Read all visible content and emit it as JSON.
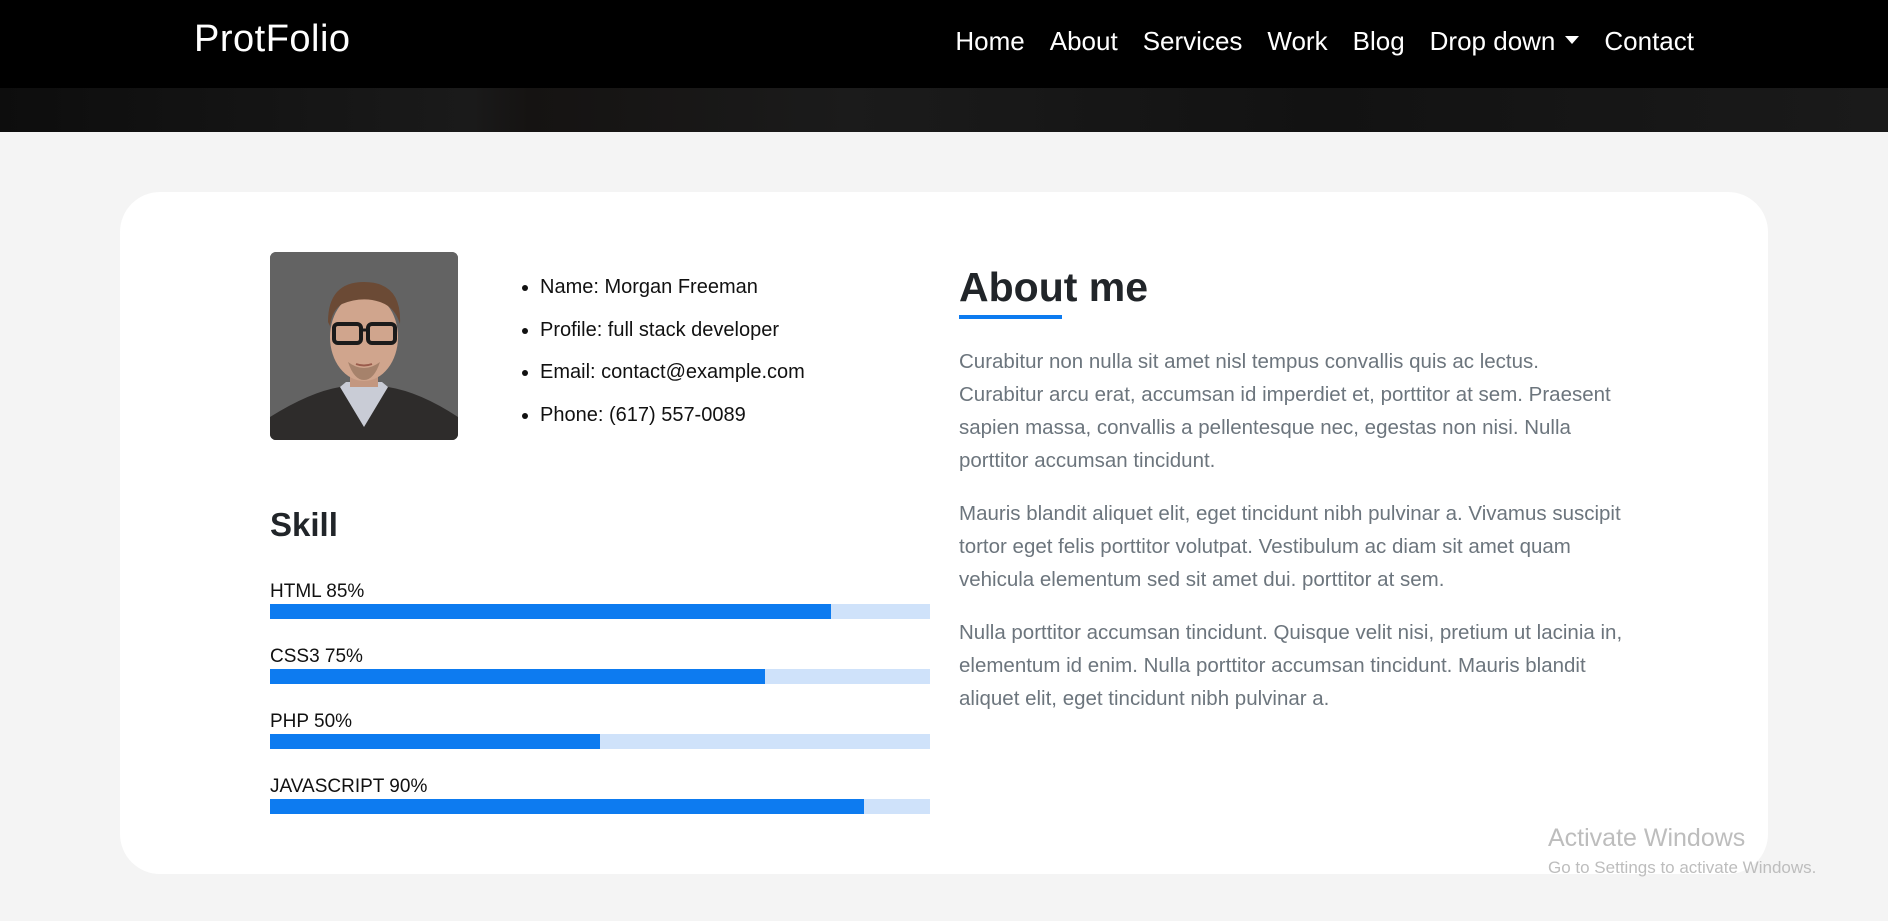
{
  "navbar": {
    "brand": "ProtFolio",
    "links": [
      "Home",
      "About",
      "Services",
      "Work",
      "Blog",
      "Drop down",
      "Contact"
    ]
  },
  "profile": {
    "info": [
      "Name: Morgan Freeman",
      "Profile: full stack developer",
      "Email: contact@example.com",
      "Phone: (617) 557-0089"
    ]
  },
  "skills": {
    "title": "Skill",
    "items": [
      {
        "label": "HTML 85%",
        "percent": 85
      },
      {
        "label": "CSS3 75%",
        "percent": 75
      },
      {
        "label": "PHP 50%",
        "percent": 50
      },
      {
        "label": "JAVASCRIPT 90%",
        "percent": 90
      }
    ]
  },
  "about": {
    "title": "About me",
    "paragraphs": [
      "Curabitur non nulla sit amet nisl tempus convallis quis ac lectus. Curabitur arcu erat, accumsan id imperdiet et, porttitor at sem. Praesent sapien massa, convallis a pellentesque nec, egestas non nisi. Nulla porttitor accumsan tincidunt.",
      "Mauris blandit aliquet elit, eget tincidunt nibh pulvinar a. Vivamus suscipit tortor eget felis porttitor volutpat. Vestibulum ac diam sit amet quam vehicula elementum sed sit amet dui. porttitor at sem.",
      "Nulla porttitor accumsan tincidunt. Quisque velit nisi, pretium ut lacinia in, elementum id enim. Nulla porttitor accumsan tincidunt. Mauris blandit aliquet elit, eget tincidunt nibh pulvinar a."
    ]
  },
  "watermark": {
    "title": "Activate Windows",
    "subtitle": "Go to Settings to activate Windows."
  },
  "colors": {
    "accent": "#0d7bf0",
    "bar_track": "#cfe2fa",
    "navbar_bg": "#000000",
    "page_bg": "#f4f4f4"
  },
  "icons": {
    "dropdown": "caret-down-icon"
  }
}
